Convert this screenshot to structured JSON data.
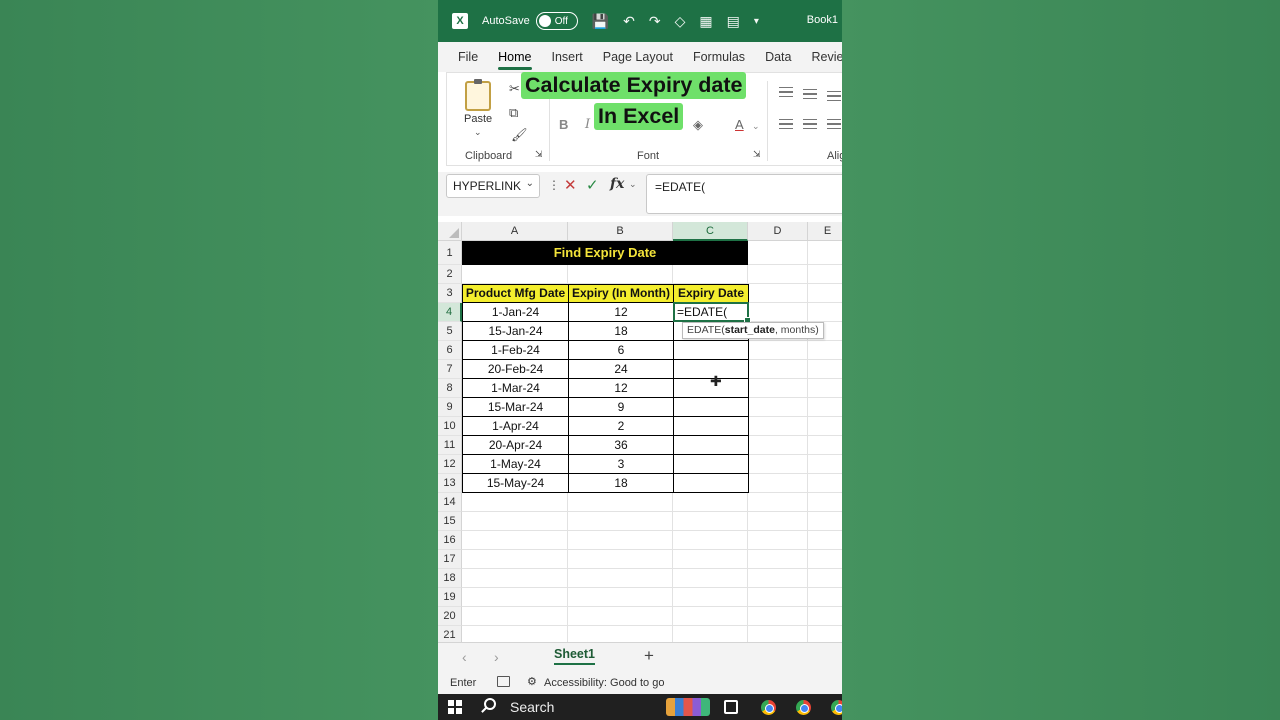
{
  "titlebar": {
    "autosave_label": "AutoSave",
    "autosave_state": "Off",
    "book_title": "Book1"
  },
  "ribbon_tabs": [
    "File",
    "Home",
    "Insert",
    "Page Layout",
    "Formulas",
    "Data",
    "Review"
  ],
  "ribbon": {
    "paste_label": "Paste",
    "clipboard_label": "Clipboard",
    "font_label": "Font",
    "alignment_label_partial": "Alig"
  },
  "overlay": {
    "line1": "Calculate Expiry date",
    "line2": "In Excel"
  },
  "formula_bar": {
    "name_box": "HYPERLINK",
    "formula": "=EDATE("
  },
  "columns": [
    "A",
    "B",
    "C",
    "D",
    "E"
  ],
  "rows": [
    "1",
    "2",
    "3",
    "4",
    "5",
    "6",
    "7",
    "8",
    "9",
    "10",
    "11",
    "12",
    "13",
    "14",
    "15",
    "16",
    "17",
    "18",
    "19",
    "20",
    "21"
  ],
  "table": {
    "title": "Find Expiry Date",
    "headers": [
      "Product Mfg Date",
      "Expiry (In Month)",
      "Expiry Date"
    ],
    "rows": [
      {
        "mfg": "1-Jan-24",
        "months": "12"
      },
      {
        "mfg": "15-Jan-24",
        "months": "18"
      },
      {
        "mfg": "1-Feb-24",
        "months": "6"
      },
      {
        "mfg": "20-Feb-24",
        "months": "24"
      },
      {
        "mfg": "1-Mar-24",
        "months": "12"
      },
      {
        "mfg": "15-Mar-24",
        "months": "9"
      },
      {
        "mfg": "1-Apr-24",
        "months": "2"
      },
      {
        "mfg": "20-Apr-24",
        "months": "36"
      },
      {
        "mfg": "1-May-24",
        "months": "3"
      },
      {
        "mfg": "15-May-24",
        "months": "18"
      }
    ],
    "active_cell_text": "=EDATE(",
    "tooltip": {
      "fn": "EDATE(",
      "arg1": "start_date",
      "rest": ", months)"
    }
  },
  "sheets": [
    "Sheet1"
  ],
  "status": {
    "mode": "Enter",
    "accessibility": "Accessibility: Good to go"
  },
  "taskbar": {
    "search_label": "Search"
  },
  "colors": {
    "excel_green": "#1e7145",
    "header_yellow": "#f4ee2e",
    "title_text": "#f4e43a",
    "overlay_green": "#6fe06a"
  }
}
